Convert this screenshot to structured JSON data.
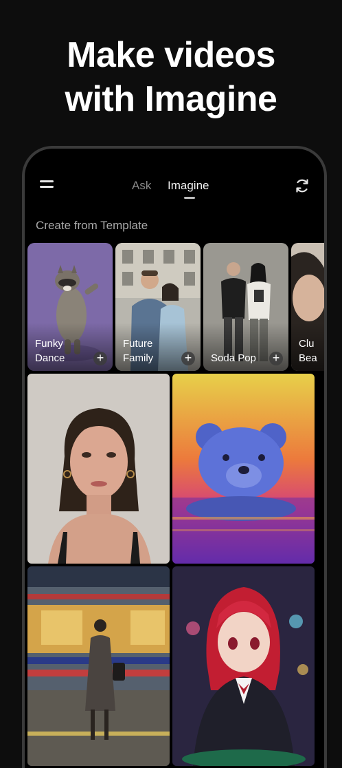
{
  "headline": {
    "line1": "Make videos",
    "line2": "with Imagine"
  },
  "appbar": {
    "tabs": [
      {
        "label": "Ask",
        "active": false
      },
      {
        "label": "Imagine",
        "active": true
      }
    ],
    "menu_icon": "hamburger-menu-icon",
    "refresh_icon": "refresh-icon"
  },
  "section": {
    "title": "Create from Template"
  },
  "templates": [
    {
      "label": "Funky\nDance",
      "bg": "#7d6aa8"
    },
    {
      "label": "Future\nFamily",
      "bg": "#7a8796"
    },
    {
      "label": "Soda Pop",
      "bg": "#9a9891"
    },
    {
      "label": "Clu\nBea",
      "bg": "#c9bfb3"
    }
  ],
  "gallery": [
    {
      "name": "portrait-woman",
      "bg": "#cfcac4"
    },
    {
      "name": "blue-bear-sunset",
      "bg": "#e06a3a"
    },
    {
      "name": "woman-train-platform",
      "bg": "#2b3446"
    },
    {
      "name": "anime-casino-girl",
      "bg": "#2a2540"
    }
  ],
  "colors": {
    "background": "#0d0d0d",
    "phone_frame": "#3a3a3a",
    "muted_text": "#a9a9a9"
  }
}
